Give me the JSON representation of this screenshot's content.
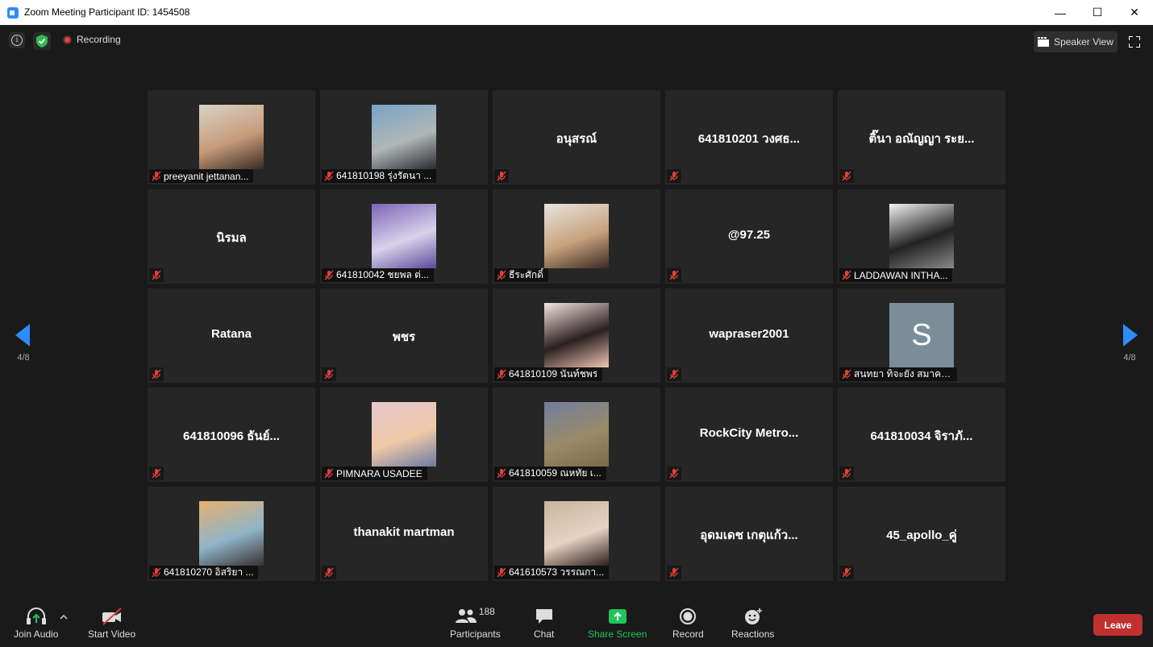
{
  "window": {
    "title": "Zoom Meeting Participant ID: 1454508"
  },
  "topbar": {
    "recording_label": "Recording",
    "speaker_view_label": "Speaker View"
  },
  "colors": {
    "accent_blue": "#2d8cff",
    "share_green": "#22c35a",
    "leave_red": "#c0302f",
    "muted_red": "#e0403a",
    "shield_green": "#2fbb4f"
  },
  "pager": {
    "left_page": "4/8",
    "right_page": "4/8"
  },
  "tiles": [
    {
      "name": "",
      "label": "preeyanit jettanan...",
      "has_photo": true,
      "photo_colors": [
        "#d9d3c8",
        "#c79b7a",
        "#3a2a22"
      ]
    },
    {
      "name": "",
      "label": "641810198 รุ่งรัตนา ...",
      "has_photo": true,
      "photo_colors": [
        "#7aa3c8",
        "#b0b7b7",
        "#2a2a33"
      ]
    },
    {
      "name": "อนุสรณ์",
      "label": "",
      "has_photo": false
    },
    {
      "name": "641810201 วงศธ...",
      "label": "",
      "has_photo": false
    },
    {
      "name": "ติ๊นา อณัญญา ระย...",
      "label": "",
      "has_photo": false
    },
    {
      "name": "นิรมล",
      "label": "",
      "has_photo": false
    },
    {
      "name": "",
      "label": "641810042 ชยพล ต่...",
      "has_photo": true,
      "photo_colors": [
        "#7c64b8",
        "#d8d3ea",
        "#5b4a9a"
      ]
    },
    {
      "name": "",
      "label": "ธีระศักดิ์",
      "has_photo": true,
      "photo_colors": [
        "#e8e4df",
        "#c7a27d",
        "#3a2a22"
      ]
    },
    {
      "name": "@97.25",
      "label": "",
      "has_photo": false
    },
    {
      "name": "",
      "label": "LADDAWAN INTHA...",
      "has_photo": true,
      "photo_colors": [
        "#f4f4f4",
        "#222222",
        "#8a8a8a"
      ]
    },
    {
      "name": "Ratana",
      "label": "",
      "has_photo": false
    },
    {
      "name": "พชร",
      "label": "",
      "has_photo": false
    },
    {
      "name": "",
      "label": "641810109 นันท์ชพร",
      "has_photo": true,
      "photo_colors": [
        "#f1e6e2",
        "#2b2020",
        "#f0c6b4"
      ]
    },
    {
      "name": "wapraser2001",
      "label": "",
      "has_photo": false
    },
    {
      "name": "",
      "label": "สนทยา ทิจะยัง สมาคม...",
      "has_photo": true,
      "avatar_letter": "S",
      "photo_colors": [
        "#7a8d99"
      ]
    },
    {
      "name": "641810096 ธันย์...",
      "label": "",
      "has_photo": false
    },
    {
      "name": "",
      "label": "PIMNARA USADEE",
      "has_photo": true,
      "photo_colors": [
        "#e6c8d0",
        "#f0c9a8",
        "#6a7aa2"
      ]
    },
    {
      "name": "",
      "label": "641810059 ณหทัย เ...",
      "has_photo": true,
      "photo_colors": [
        "#6f7f9c",
        "#9a8a6a",
        "#7a6a4a"
      ]
    },
    {
      "name": "RockCity  Metro...",
      "label": "",
      "has_photo": false
    },
    {
      "name": "641810034 จิราภั...",
      "label": "",
      "has_photo": false
    },
    {
      "name": "",
      "label": "641810270 อิสริยา ...",
      "has_photo": true,
      "photo_colors": [
        "#e6b070",
        "#8fb5c9",
        "#3a3030"
      ]
    },
    {
      "name": "thanakit martman",
      "label": "",
      "has_photo": false
    },
    {
      "name": "",
      "label": "641610573 วรรณกา...",
      "has_photo": true,
      "photo_colors": [
        "#c7b59c",
        "#e8d2c4",
        "#2a1f1a"
      ]
    },
    {
      "name": "อุดมเดช เกตุแก้ว...",
      "label": "",
      "has_photo": false
    },
    {
      "name": "45_apollo_คู่",
      "label": "",
      "has_photo": false
    }
  ],
  "toolbar": {
    "join_audio": "Join Audio",
    "start_video": "Start Video",
    "participants": "Participants",
    "participants_count": "188",
    "chat": "Chat",
    "share_screen": "Share Screen",
    "record": "Record",
    "reactions": "Reactions",
    "leave": "Leave"
  }
}
